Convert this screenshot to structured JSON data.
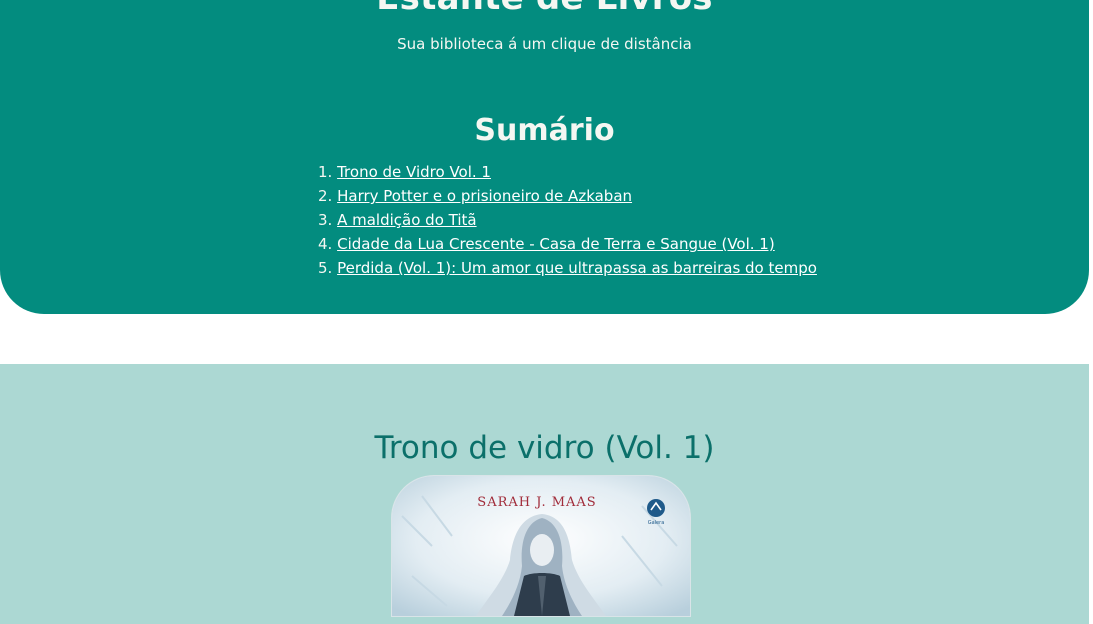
{
  "header": {
    "title": "Estante de Livros",
    "tagline": "Sua biblioteca á um clique de distância"
  },
  "toc": {
    "title": "Sumário",
    "items": [
      {
        "num": "1.",
        "label": "Trono de Vidro Vol. 1"
      },
      {
        "num": "2.",
        "label": "Harry Potter e o prisioneiro de Azkaban"
      },
      {
        "num": "3.",
        "label": "A maldição do Titã"
      },
      {
        "num": "4.",
        "label": "Cidade da Lua Crescente - Casa de Terra e Sangue (Vol. 1)"
      },
      {
        "num": "5.",
        "label": "Perdida (Vol. 1): Um amor que ultrapassa as barreiras do tempo"
      }
    ]
  },
  "book": {
    "title": "Trono de vidro (Vol. 1)",
    "cover_author": "SARAH J. MAAS",
    "cover_publisher": "Galera"
  },
  "colors": {
    "header_bg": "#038c7f",
    "section_bg": "#acd8d3",
    "book_title": "#0b706a"
  }
}
